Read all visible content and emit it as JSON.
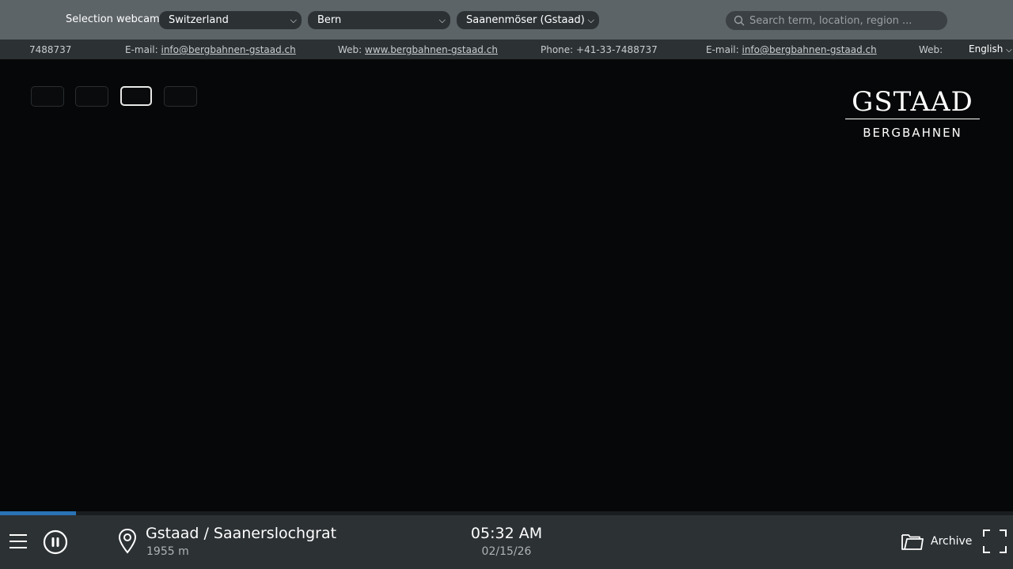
{
  "header": {
    "selection_label": "Selection webcam:",
    "country": "Switzerland",
    "region": "Bern",
    "location": "Saanenmöser (Gstaad)",
    "search_placeholder": "Search term, location, region ..."
  },
  "ticker": {
    "items": [
      {
        "label": "",
        "value": "7488737"
      },
      {
        "label": "E-mail: ",
        "value": "info@bergbahnen-gstaad.ch"
      },
      {
        "label": "Web: ",
        "value": "www.bergbahnen-gstaad.ch"
      },
      {
        "label": "Phone: ",
        "value": "+41-33-7488737"
      },
      {
        "label": "E-mail: ",
        "value": "info@bergbahnen-gstaad.ch"
      },
      {
        "label": "Web:",
        "value": ""
      }
    ],
    "language": "English"
  },
  "logo": {
    "main": "GSTAAD",
    "sub": "BERGBAHNEN"
  },
  "player": {
    "progress": 0.075,
    "active_thumb": 3,
    "thumb_count": 4
  },
  "footer": {
    "location_name": "Gstaad / Saanerslochgrat",
    "altitude": "1955 m",
    "time": "05:32 AM",
    "date": "02/15/26",
    "archive_label": "Archive"
  },
  "colors": {
    "accent": "#2a73b5",
    "topbar": "#5d6468",
    "bar": "#2c3134"
  }
}
